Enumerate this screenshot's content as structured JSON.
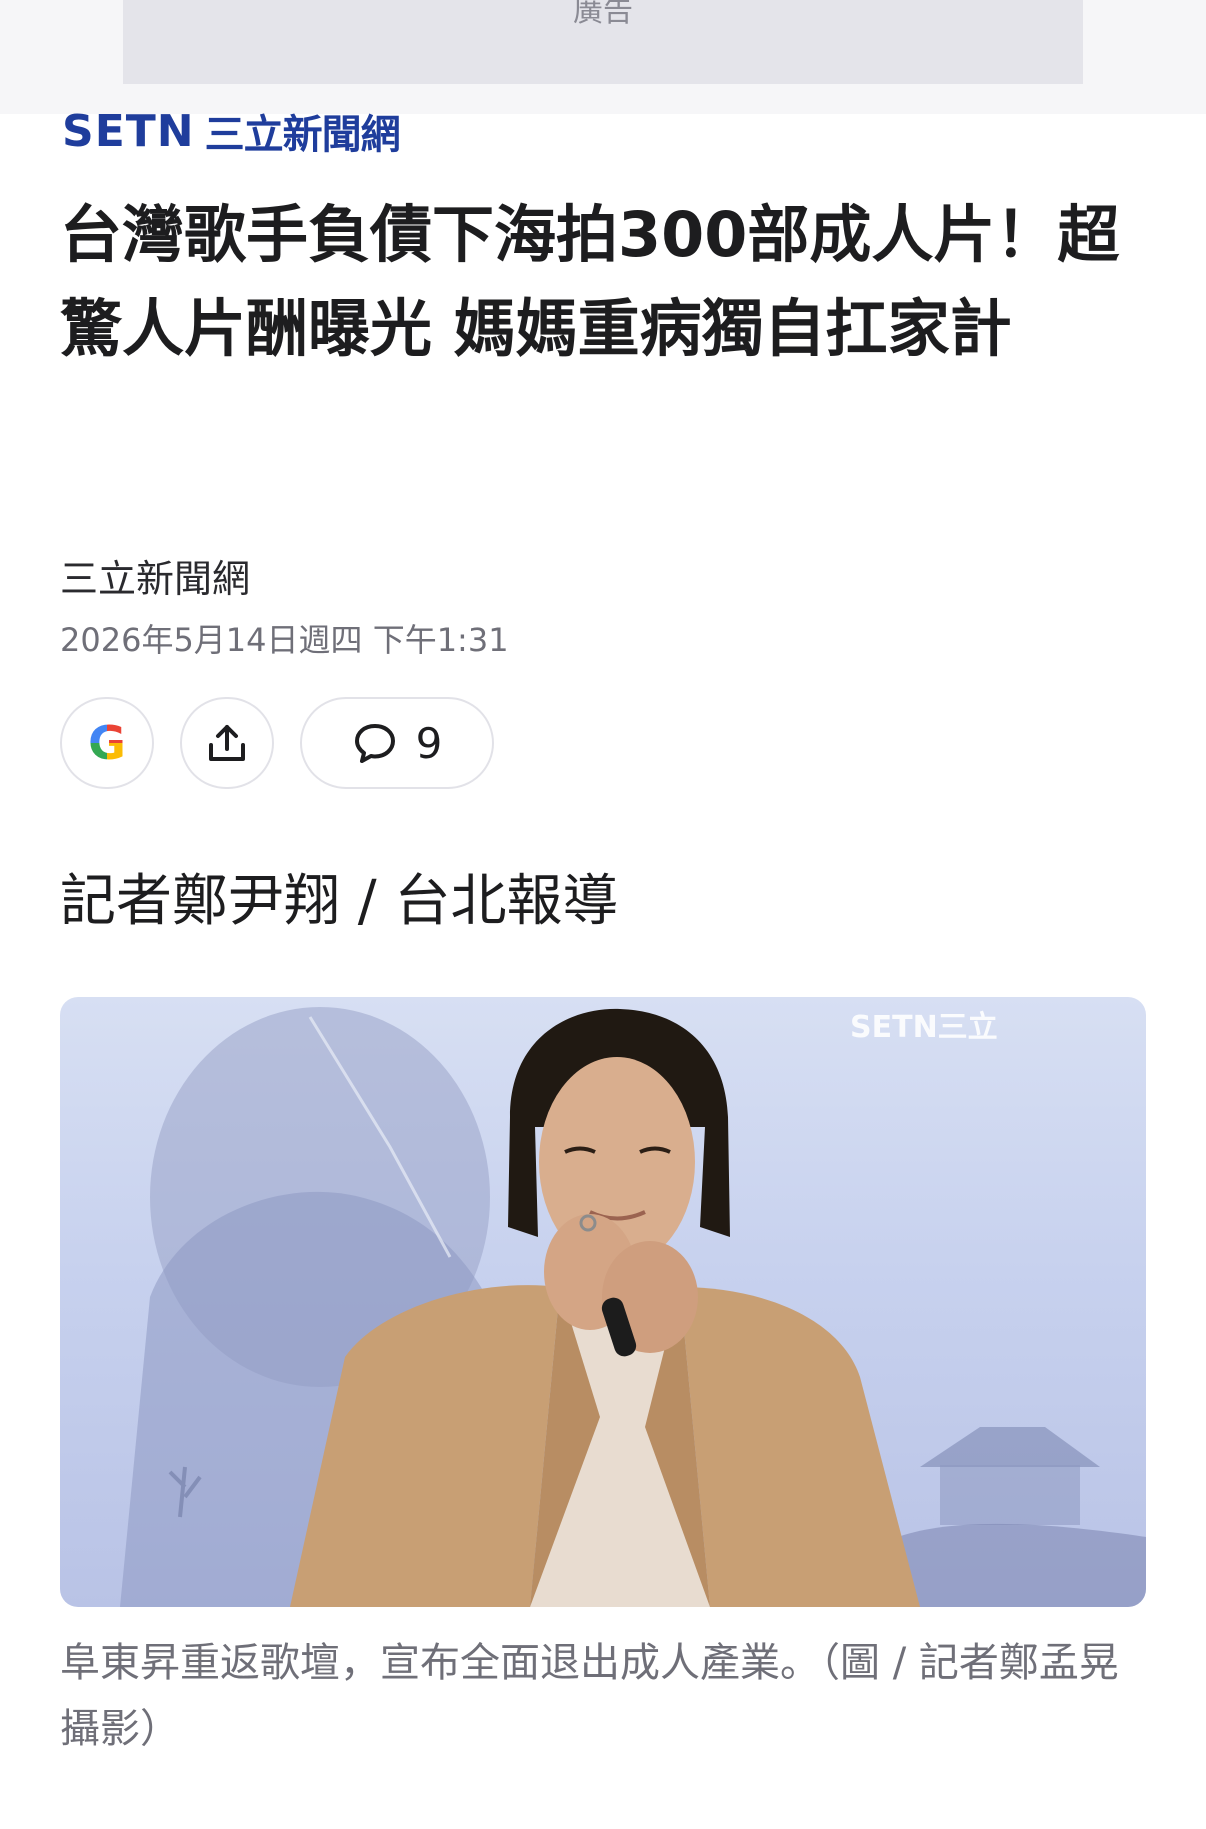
{
  "ad": {
    "label": "廣告"
  },
  "logo": {
    "brand_latin": "SETN",
    "brand_cn": "三立新聞網"
  },
  "article": {
    "title": "台灣歌手負債下海拍300部成人片！超驚人片酬曝光 媽媽重病獨自扛家計",
    "source": "三立新聞網",
    "timestamp": "2026年5月14日週四 下午1:31",
    "byline": "記者鄭尹翔 / 台北報導",
    "caption": "阜東昇重返歌壇，宣布全面退出成人產業。（圖 / 記者鄭孟晃攝影）"
  },
  "actions": {
    "comment_count": "9"
  },
  "photo": {
    "watermark": "SETN三立"
  },
  "colors": {
    "brand_blue": "#1f3d9c",
    "coat": "#c89f74",
    "backdrop": "#c7d1ee"
  },
  "icons": [
    "google-icon",
    "share-icon",
    "comment-icon"
  ]
}
